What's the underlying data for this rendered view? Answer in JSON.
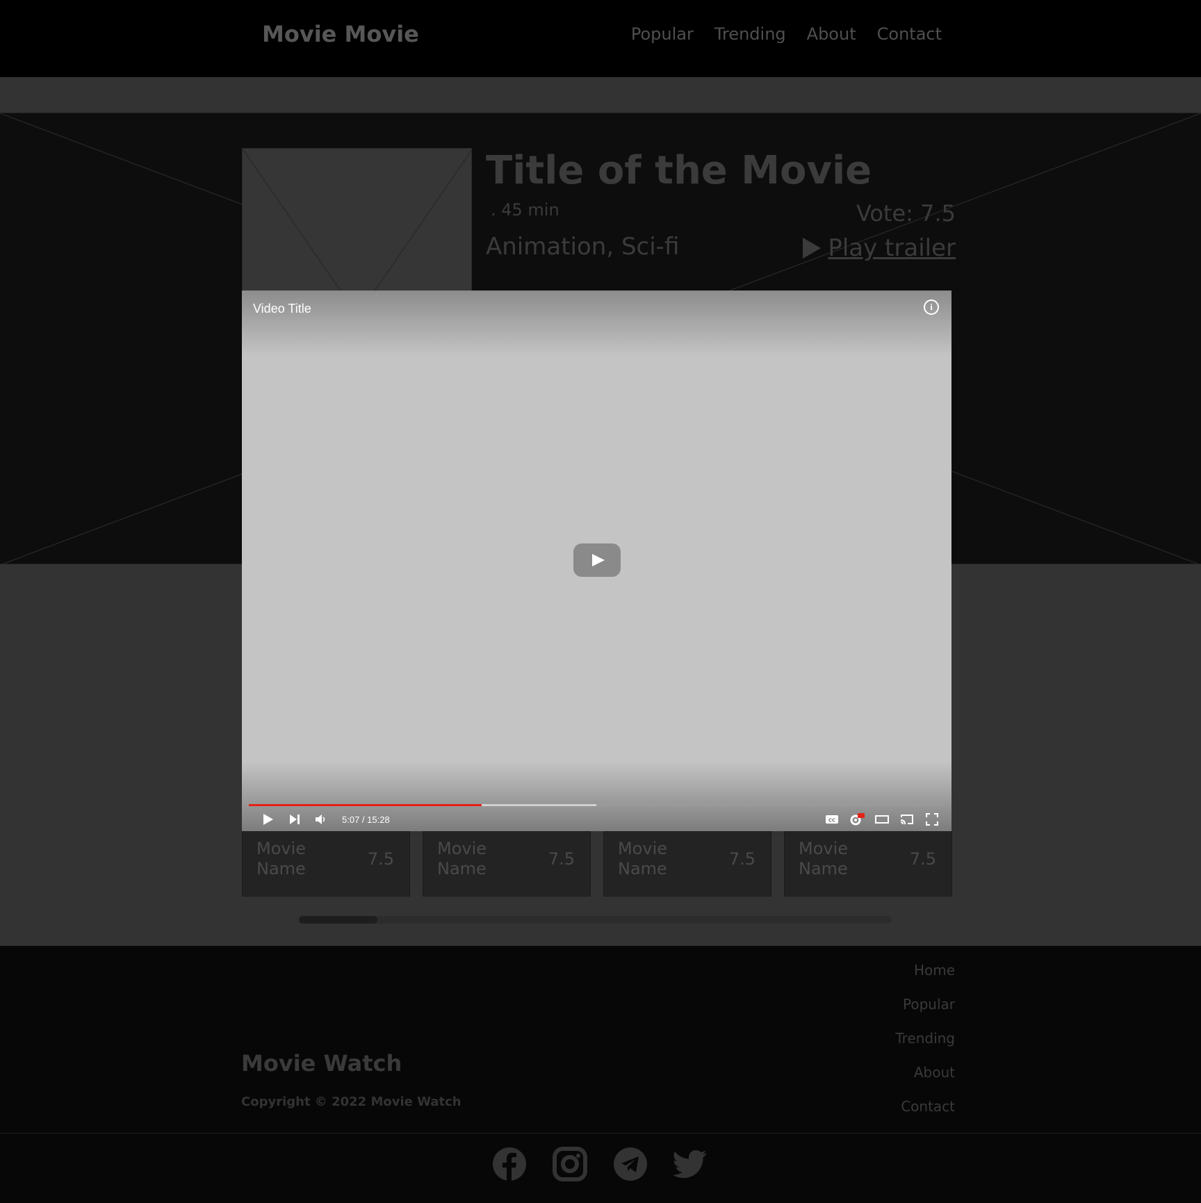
{
  "header": {
    "brand": "Movie Movie",
    "nav": [
      "Popular",
      "Trending",
      "About",
      "Contact"
    ]
  },
  "movie": {
    "title": "Title of  the Movie",
    "runtime": ". 45 min",
    "genres": "Animation, Sci-fi",
    "vote": "Vote: 7.5",
    "trailer_label": "Play trailer"
  },
  "player": {
    "video_title": "Video Title",
    "info_label": "i",
    "time": "5:07 / 15:28",
    "played_fraction": 0.335,
    "buffered_fraction": 0.5,
    "progress_color": "#e62117"
  },
  "cards": [
    {
      "name": "Movie Name",
      "rating": "7.5"
    },
    {
      "name": "Movie Name",
      "rating": "7.5"
    },
    {
      "name": "Movie Name",
      "rating": "7.5"
    },
    {
      "name": "Movie Name",
      "rating": "7.5"
    }
  ],
  "footer": {
    "brand": "Movie Watch",
    "copyright": "Copyright © 2022 Movie Watch",
    "links": [
      "Home",
      "Popular",
      "Trending",
      "About",
      "Contact"
    ],
    "socials": [
      "facebook-icon",
      "instagram-icon",
      "telegram-icon",
      "twitter-icon"
    ]
  }
}
